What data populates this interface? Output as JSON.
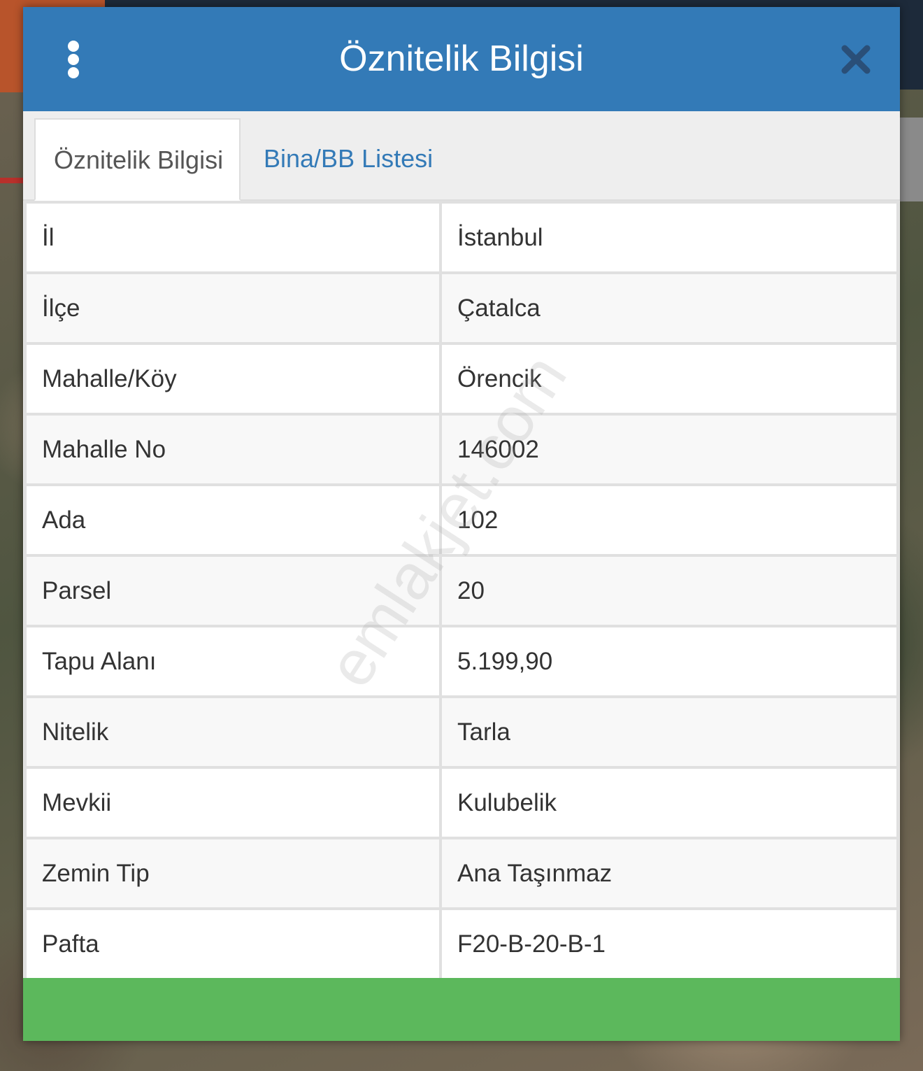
{
  "dialog": {
    "title": "Öznitelik Bilgisi",
    "menu_icon": "vertical-dots-icon",
    "close_icon": "close-x-icon"
  },
  "tabs": [
    {
      "label": "Öznitelik Bilgisi",
      "active": true
    },
    {
      "label": "Bina/BB Listesi",
      "active": false
    }
  ],
  "rows": [
    {
      "label": "İl",
      "value": "İstanbul"
    },
    {
      "label": "İlçe",
      "value": "Çatalca"
    },
    {
      "label": "Mahalle/Köy",
      "value": "Örencik"
    },
    {
      "label": "Mahalle No",
      "value": "146002"
    },
    {
      "label": "Ada",
      "value": "102"
    },
    {
      "label": "Parsel",
      "value": "20"
    },
    {
      "label": "Tapu Alanı",
      "value": "5.199,90"
    },
    {
      "label": "Nitelik",
      "value": "Tarla"
    },
    {
      "label": "Mevkii",
      "value": "Kulubelik"
    },
    {
      "label": "Zemin Tip",
      "value": "Ana Taşınmaz"
    },
    {
      "label": "Pafta",
      "value": "F20-B-20-B-1"
    }
  ],
  "watermark": "emlakjet.com",
  "colors": {
    "header": "#337ab7",
    "footer": "#5cb85c",
    "tab_link": "#337ab7"
  }
}
